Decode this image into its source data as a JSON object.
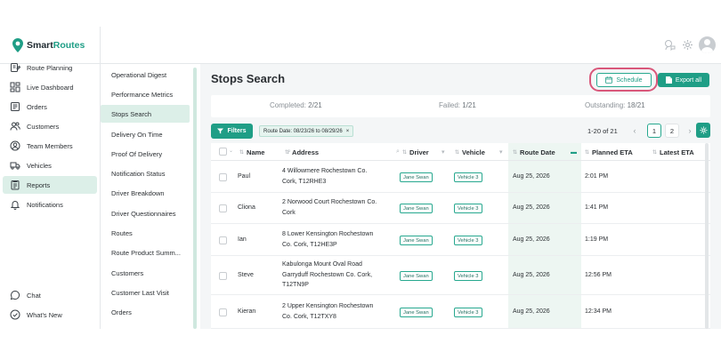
{
  "brand": {
    "prefix": "Smart",
    "accent": "Routes"
  },
  "left_nav": [
    {
      "label": "Route Planning",
      "icon": "route-planning-icon"
    },
    {
      "label": "Live Dashboard",
      "icon": "dashboard-icon"
    },
    {
      "label": "Orders",
      "icon": "orders-icon"
    },
    {
      "label": "Customers",
      "icon": "customers-icon"
    },
    {
      "label": "Team Members",
      "icon": "team-members-icon"
    },
    {
      "label": "Vehicles",
      "icon": "vehicles-icon"
    },
    {
      "label": "Reports",
      "icon": "reports-icon",
      "active": true
    },
    {
      "label": "Notifications",
      "icon": "notifications-icon"
    }
  ],
  "bottom_nav": [
    {
      "label": "Chat",
      "icon": "chat-icon"
    },
    {
      "label": "What's New",
      "icon": "whats-new-icon"
    }
  ],
  "reports": [
    "Operational Digest",
    "Performance Metrics",
    "Stops Search",
    "Delivery On Time",
    "Proof Of Delivery",
    "Notification Status",
    "Driver Breakdown",
    "Driver Questionnaires",
    "Routes",
    "Route Product Summ...",
    "Customers",
    "Customer Last Visit",
    "Orders"
  ],
  "active_report": "Stops Search",
  "page": {
    "title": "Stops Search",
    "schedule_label": "Schedule",
    "export_label": "Export all"
  },
  "summary": {
    "completed_label": "Completed:",
    "completed_value": "2/21",
    "failed_label": "Failed:",
    "failed_value": "1/21",
    "outstanding_label": "Outstanding:",
    "outstanding_value": "18/21"
  },
  "filters": {
    "button_label": "Filters",
    "chip_label": "Route Date: 08/23/26 to 08/29/26",
    "chip_close": "×"
  },
  "pagination": {
    "range_text": "1-20 of 21",
    "prev": "‹",
    "next": "›",
    "pages": [
      "1",
      "2"
    ],
    "current": "1"
  },
  "table": {
    "columns": [
      "Name",
      "Address",
      "Driver",
      "Vehicle",
      "Route Date",
      "Planned ETA",
      "Latest ETA"
    ],
    "rows": [
      {
        "name": "Paul",
        "address": [
          "4 Willowmere Rochestown Co.",
          "Cork, T12RHE3"
        ],
        "driver": "Jane Swan",
        "vehicle": "Vehicle 3",
        "route_date": "Aug 25, 2026",
        "planned_eta": "2:01 PM",
        "latest_eta": ""
      },
      {
        "name": "Cliona",
        "address": [
          "2 Norwood Court Rochestown Co.",
          "Cork"
        ],
        "driver": "Jane Swan",
        "vehicle": "Vehicle 3",
        "route_date": "Aug 25, 2026",
        "planned_eta": "1:41 PM",
        "latest_eta": ""
      },
      {
        "name": "Ian",
        "address": [
          "8 Lower Kensington Rochestown",
          "Co. Cork, T12HE3P"
        ],
        "driver": "Jane Swan",
        "vehicle": "Vehicle 3",
        "route_date": "Aug 25, 2026",
        "planned_eta": "1:19 PM",
        "latest_eta": ""
      },
      {
        "name": "Steve",
        "address": [
          "Kabulonga Mount Oval Road",
          "Garryduff Rochestown Co. Cork,",
          "T12TN9P"
        ],
        "driver": "Jane Swan",
        "vehicle": "Vehicle 3",
        "route_date": "Aug 25, 2026",
        "planned_eta": "12:56 PM",
        "latest_eta": ""
      },
      {
        "name": "Kieran",
        "address": [
          "2 Upper Kensington Rochestown",
          "Co. Cork, T12TXY8"
        ],
        "driver": "Jane Swan",
        "vehicle": "Vehicle 3",
        "route_date": "Aug 25, 2026",
        "planned_eta": "12:34 PM",
        "latest_eta": ""
      }
    ]
  },
  "colors": {
    "accent": "#1f9e86",
    "active_bg": "#dcefe8",
    "highlight_ring": "#d9577a"
  }
}
